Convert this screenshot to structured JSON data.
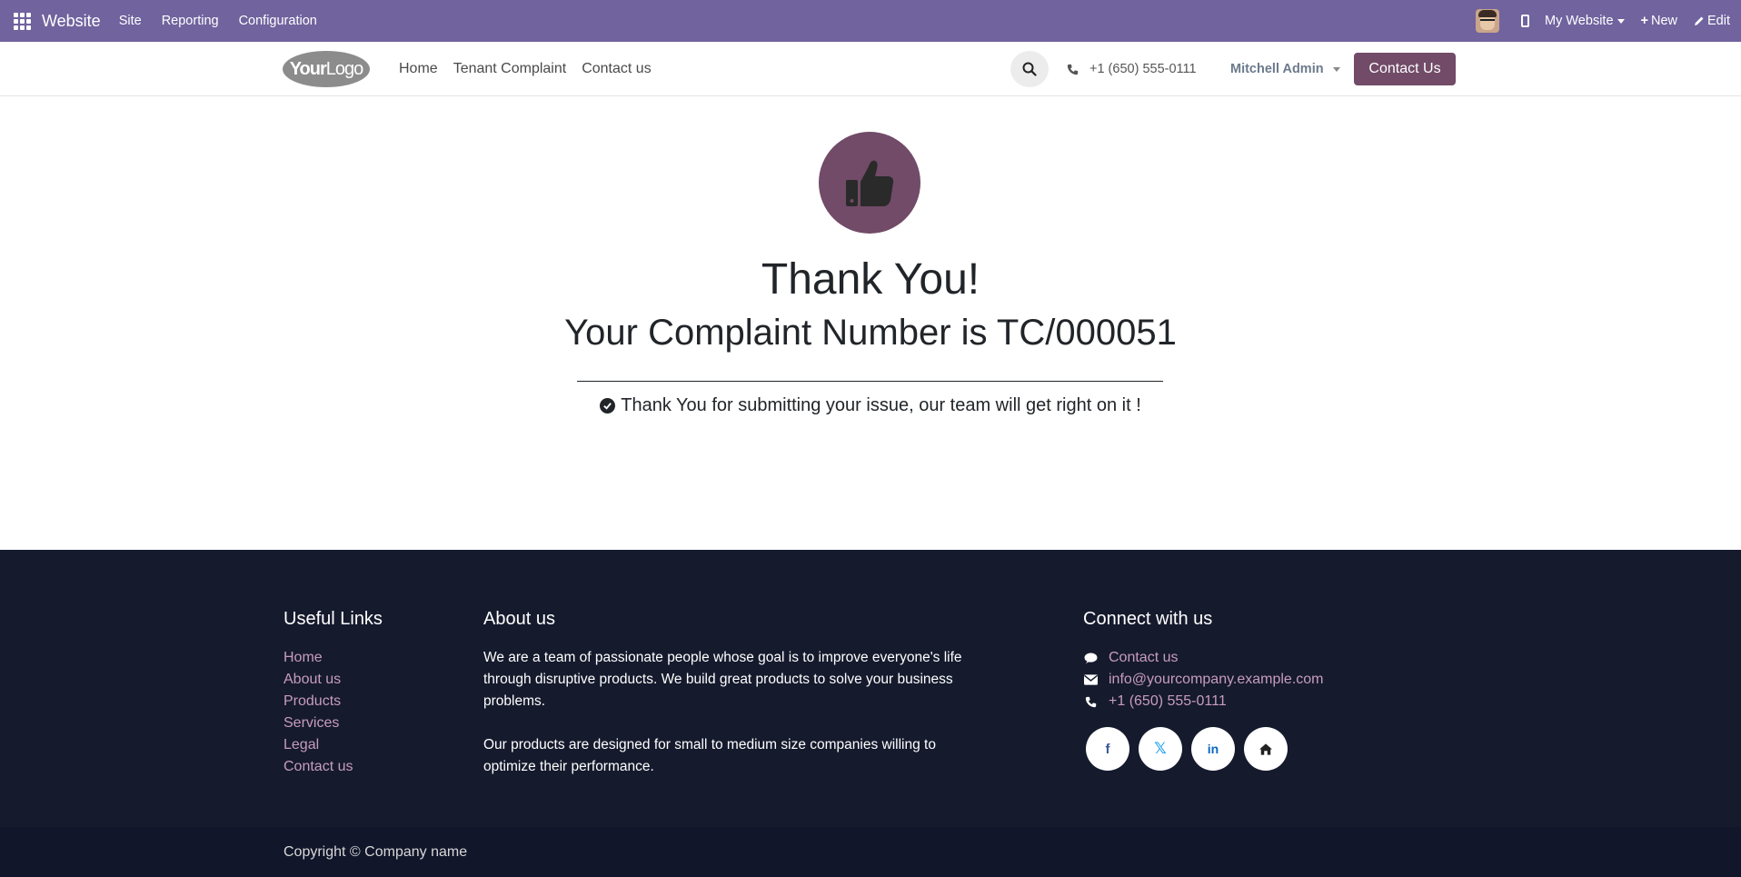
{
  "adminbar": {
    "brand": "Website",
    "menus": [
      "Site",
      "Reporting",
      "Configuration"
    ],
    "my_website": "My Website",
    "new_label": "New",
    "edit_label": "Edit"
  },
  "header": {
    "logo_text_bold": "Your",
    "logo_text": "Logo",
    "nav": [
      "Home",
      "Tenant Complaint",
      "Contact us"
    ],
    "phone": "+1 (650) 555-0111",
    "user": "Mitchell Admin",
    "contact_button": "Contact Us"
  },
  "main": {
    "title": "Thank You!",
    "complaint_line": "Your Complaint Number is TC/000051",
    "message": "Thank You for submitting your issue, our team will get right on it !"
  },
  "footer": {
    "useful_links_title": "Useful Links",
    "useful_links": [
      "Home",
      "About us",
      "Products",
      "Services",
      "Legal",
      "Contact us"
    ],
    "about_title": "About us",
    "about_p1": "We are a team of passionate people whose goal is to improve everyone's life through disruptive products. We build great products to solve your business problems.",
    "about_p2": "Our products are designed for small to medium size companies willing to optimize their performance.",
    "connect_title": "Connect with us",
    "connect_contact": "Contact us",
    "connect_email": "info@yourcompany.example.com",
    "connect_phone": "+1 (650) 555-0111",
    "socials": {
      "facebook": "f",
      "x": "𝕏",
      "linkedin": "in"
    },
    "copyright": "Copyright © Company name"
  },
  "colors": {
    "adminbar": "#71639e",
    "brand_primary": "#714b67",
    "footer_bg": "#151a2d",
    "footer_link": "#c79cbd"
  }
}
